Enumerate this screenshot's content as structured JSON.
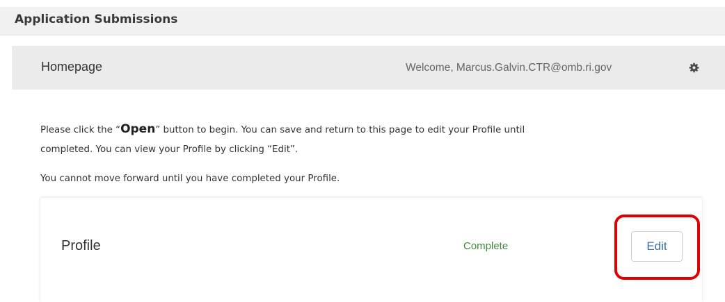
{
  "header": {
    "title": "Application Submissions"
  },
  "nav": {
    "title": "Homepage",
    "welcome": "Welcome, Marcus.Galvin.CTR@omb.ri.gov",
    "settings_icon": "gear-icon"
  },
  "instructions": {
    "line1_prefix": "Please click the “",
    "line1_open": "Open",
    "line1_suffix": "” button to begin. You can save and return to this page to edit your Profile until",
    "line2": "completed. You can view your Profile by clicking “Edit”.",
    "line3": "You cannot move forward until you have completed your Profile."
  },
  "profile_card": {
    "title": "Profile",
    "status": "Complete",
    "edit_label": "Edit"
  },
  "colors": {
    "status_complete": "#3d8b3d",
    "edit_text": "#3a6fa8",
    "highlight": "#e00000",
    "nav_bg": "#ebebeb"
  }
}
